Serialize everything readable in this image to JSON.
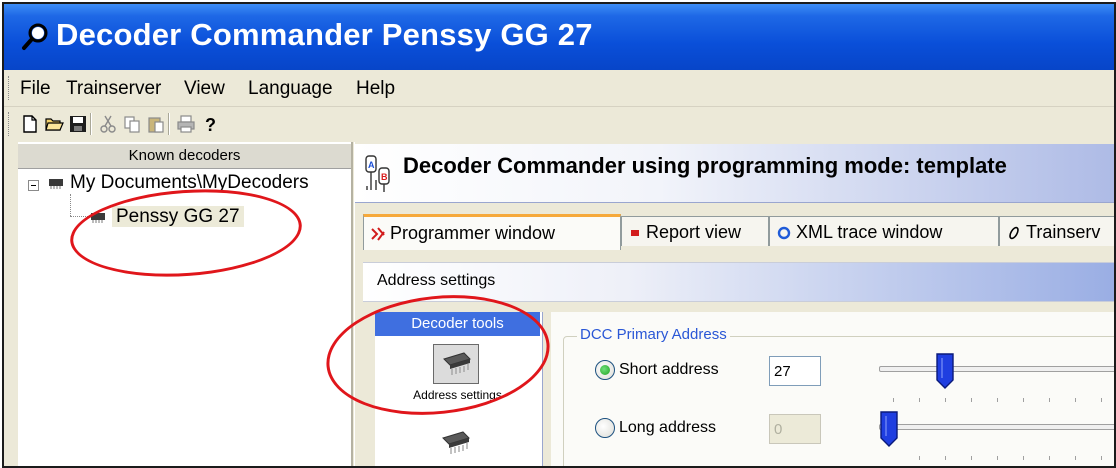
{
  "window": {
    "title": "Decoder Commander Penssy GG 27"
  },
  "menu": [
    "File",
    "Trainserver",
    "View",
    "Language",
    "Help"
  ],
  "toolbar": {
    "buttons": [
      "new-icon",
      "open-icon",
      "save-icon",
      "cut-icon",
      "copy-icon",
      "paste-icon",
      "print-icon",
      "help-icon"
    ]
  },
  "left_panel": {
    "header": "Known decoders",
    "tree": {
      "root": "My Documents\\MyDecoders",
      "child": "Penssy GG 27"
    }
  },
  "right_panel": {
    "header_title": "Decoder Commander using programming mode: template",
    "tabs": [
      "Programmer window",
      "Report view",
      "XML trace window",
      "Trainserv"
    ],
    "section_title": "Address settings",
    "tools": {
      "header": "Decoder tools",
      "items": [
        "Address settings"
      ]
    },
    "dcc": {
      "legend": "DCC Primary Address",
      "short_label": "Short address",
      "short_value": "27",
      "short_selected": true,
      "long_label": "Long address",
      "long_value": "0",
      "long_selected": false
    }
  },
  "colors": {
    "titlebar": "#0a4fd9",
    "annotation": "#e0161b",
    "tools_header": "#3f6fe0",
    "legend": "#2a57d6"
  }
}
